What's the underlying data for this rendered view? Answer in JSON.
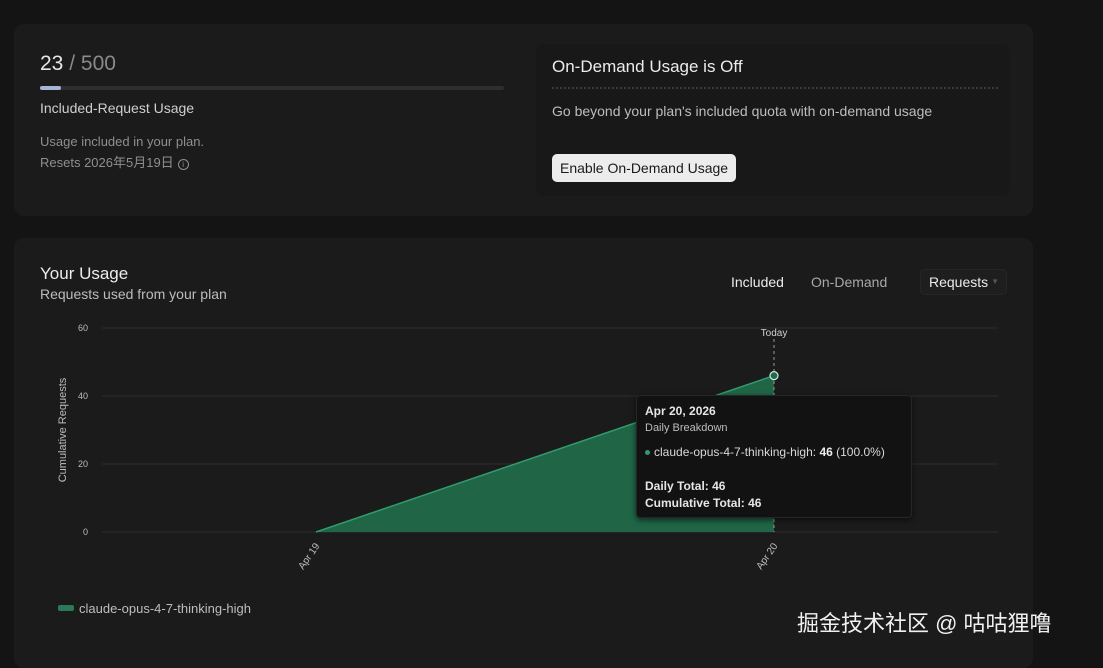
{
  "usage": {
    "used": "23",
    "separator": "/",
    "limit": "500",
    "fraction": 0.046,
    "label": "Included-Request Usage",
    "note": "Usage included in your plan.",
    "reset": "Resets 2026年5月19日"
  },
  "on_demand": {
    "title": "On-Demand Usage is Off",
    "description": "Go beyond your plan's included quota with on-demand usage",
    "button_label": "Enable On-Demand Usage"
  },
  "your_usage": {
    "title": "Your Usage",
    "subtitle": "Requests used from your plan",
    "toggles": {
      "included": "Included",
      "on_demand": "On-Demand",
      "selected": "Included"
    },
    "metric_select": "Requests"
  },
  "chart_data": {
    "type": "area",
    "x": [
      "Apr 19",
      "Apr 20"
    ],
    "series": [
      {
        "name": "claude-opus-4-7-thinking-high",
        "values": [
          0,
          46
        ]
      }
    ],
    "ylabel": "Cumulative Requests",
    "ylim": [
      0,
      60
    ],
    "yticks": [
      0,
      20,
      40,
      60
    ],
    "grid": true,
    "today_label": "Today",
    "legend_position": "bottom-left",
    "color": "#1f6b4a"
  },
  "tooltip": {
    "date": "Apr 20, 2026",
    "subtitle": "Daily Breakdown",
    "model": "claude-opus-4-7-thinking-high:",
    "model_value": "46",
    "model_pct": "(100.0%)",
    "daily_total": "Daily Total: 46",
    "cumulative_total": "Cumulative Total: 46"
  },
  "watermark": "掘金技术社区 @ 咕咕狸噜"
}
